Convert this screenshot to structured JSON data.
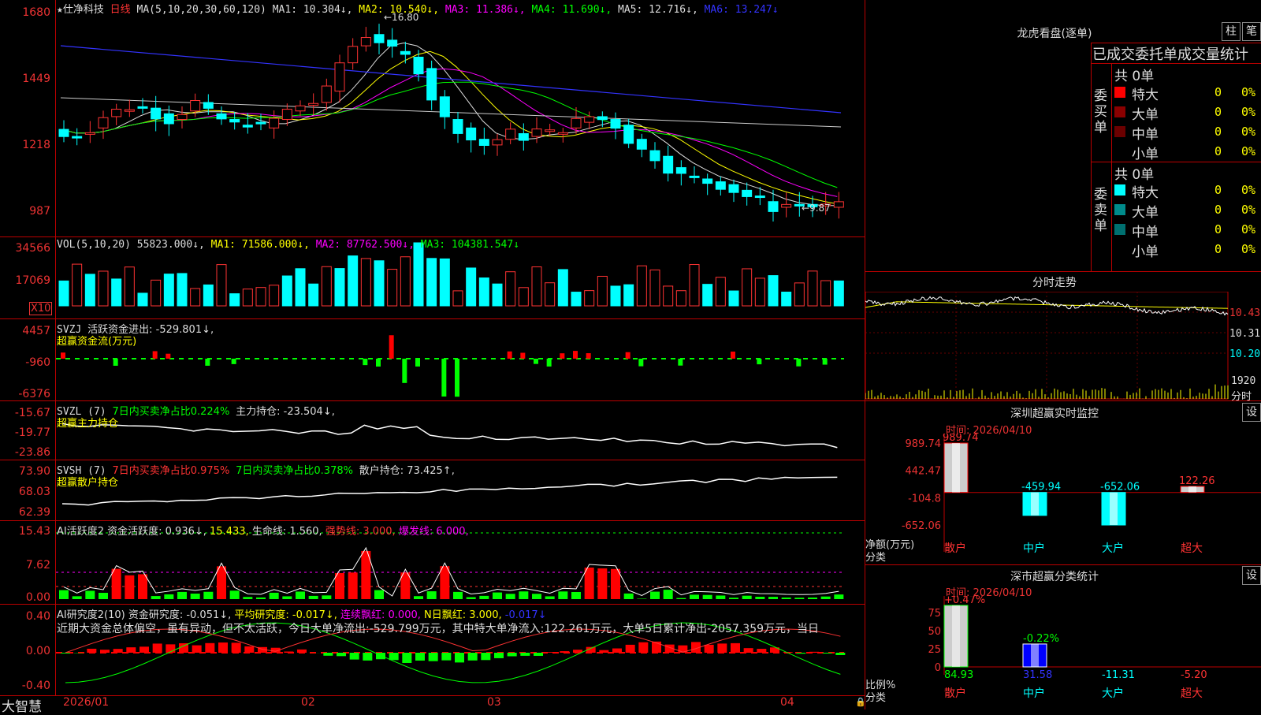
{
  "stock": {
    "star": "★",
    "name": "仕净科技",
    "period": "日线"
  },
  "ma_header": {
    "label": "MA(5,10,20,30,60,120)",
    "ma1": "MA1: 10.304↓,",
    "ma2": "MA2: 10.540↓,",
    "ma3": "MA3: 11.386↓,",
    "ma4": "MA4: 11.690↓,",
    "ma5": "MA5: 12.716↓,",
    "ma6": "MA6: 13.247↓"
  },
  "price_axis": [
    "1680",
    "1449",
    "1218",
    "987"
  ],
  "price_marks": {
    "high": "16.80",
    "low": "9.87"
  },
  "vol_header": {
    "label": "VOL(5,10,20)",
    "value": "55823.000↓,",
    "ma1": "MA1: 71586.000↓,",
    "ma2": "MA2: 87762.500↓,",
    "ma3": "MA3: 104381.547↓"
  },
  "vol_axis": [
    "34566",
    "17069"
  ],
  "vol_unit": "X10",
  "svzj_header": {
    "label": "SVZJ",
    "text": "活跃资金进出: -529.801↓,",
    "sub": "超赢资金流(万元)"
  },
  "svzj_axis": [
    "4457",
    "-960",
    "-6376"
  ],
  "svzl_header": {
    "label": "SVZL (7)",
    "t1": "7日内买卖净占比0.224%",
    "t2": "主力持仓: -23.504↓,",
    "sub": "超赢主力持仓"
  },
  "svzl_axis": [
    "-15.67",
    "-19.77",
    "-23.86"
  ],
  "svsh_header": {
    "label": "SVSH (7)",
    "t1": "7日内买卖净占比0.975%",
    "t2": "7日内买卖净占比0.378%",
    "t3": "散户持仓: 73.425↑,",
    "sub": "超赢散户持仓"
  },
  "svsh_axis": [
    "73.90",
    "68.03",
    "62.39"
  ],
  "ai_header": {
    "label": "AI活跃度2",
    "t1": "资金活跃度: 0.936↓,",
    "t2": "15.433,",
    "t3": "生命线: 1.560,",
    "t4": "强势线: 3.000,",
    "t5": "爆发线: 6.000,"
  },
  "ai_axis": [
    "15.43",
    "7.62",
    "0.00"
  ],
  "ai2_header": {
    "label": "AI研究度2(10)",
    "t1": "资金研究度: -0.051↓,",
    "t2": "平均研究度: -0.017↓,",
    "t3": "连续飘红: 0.000,",
    "t4": "N日飘红: 3.000,",
    "t5": "-0.017↓"
  },
  "ai2_text": "近期大资金总体偏空，虽有异动，但不太活跃，今日大单净流出:-529.799万元，其中特大单净流入:122.261万元，大单5日累计净出-2057.359万元，当日",
  "ai2_axis": [
    "0.40",
    "0.00",
    "-0.40"
  ],
  "date_axis": {
    "brand": "大智慧",
    "d1": "2026/01",
    "d2": "02",
    "d3": "03",
    "d4": "04"
  },
  "longhu": {
    "title": "龙虎看盘(逐单)",
    "btn1": "柱",
    "btn2": "笔",
    "header": "已成交委托单成交量统计",
    "buy_label": "委买单",
    "sell_label": "委卖单",
    "buy_total": "共 0单",
    "sell_total": "共 0单",
    "buy_rows": [
      {
        "name": "特大",
        "count": "0",
        "pct": "0%",
        "color": "#ff0000"
      },
      {
        "name": "大单",
        "count": "0",
        "pct": "0%",
        "color": "#8b0000"
      },
      {
        "name": "中单",
        "count": "0",
        "pct": "0%",
        "color": "#6b0000"
      },
      {
        "name": "小单",
        "count": "0",
        "pct": "0%",
        "color": "#000000"
      }
    ],
    "sell_rows": [
      {
        "name": "特大",
        "count": "0",
        "pct": "0%",
        "color": "#00ffff"
      },
      {
        "name": "大单",
        "count": "0",
        "pct": "0%",
        "color": "#008b8b"
      },
      {
        "name": "中单",
        "count": "0",
        "pct": "0%",
        "color": "#007070"
      },
      {
        "name": "小单",
        "count": "0",
        "pct": "0%",
        "color": "#000000"
      }
    ]
  },
  "intraday": {
    "title": "分时走势",
    "p1": "10.43",
    "p2": "10.31",
    "p3": "10.20",
    "vol": "1920",
    "unit": "分时"
  },
  "monitor": {
    "title": "深圳超赢实时监控",
    "set": "设",
    "time": "时间: 2026/04/10",
    "axis": [
      "989.74",
      "442.47",
      "-104.8",
      "-652.06"
    ],
    "ylabel1": "净额(万元)",
    "ylabel2": "分类",
    "cats": [
      "散户",
      "中户",
      "大户",
      "超大"
    ],
    "values": [
      "989.74",
      "-459.94",
      "-652.06",
      "122.26"
    ]
  },
  "classify": {
    "title": "深市超赢分类统计",
    "set": "设",
    "time": "时间: 2026/04/10",
    "axis": [
      "75",
      "50",
      "25",
      "0"
    ],
    "ylabel1": "比例%",
    "ylabel2": "分类",
    "cats": [
      "散户",
      "中户",
      "大户",
      "超大"
    ],
    "top_labels": [
      "+0.47%",
      "-0.22%"
    ],
    "values": [
      "84.93",
      "31.58",
      "-11.31",
      "-5.20"
    ]
  }
}
